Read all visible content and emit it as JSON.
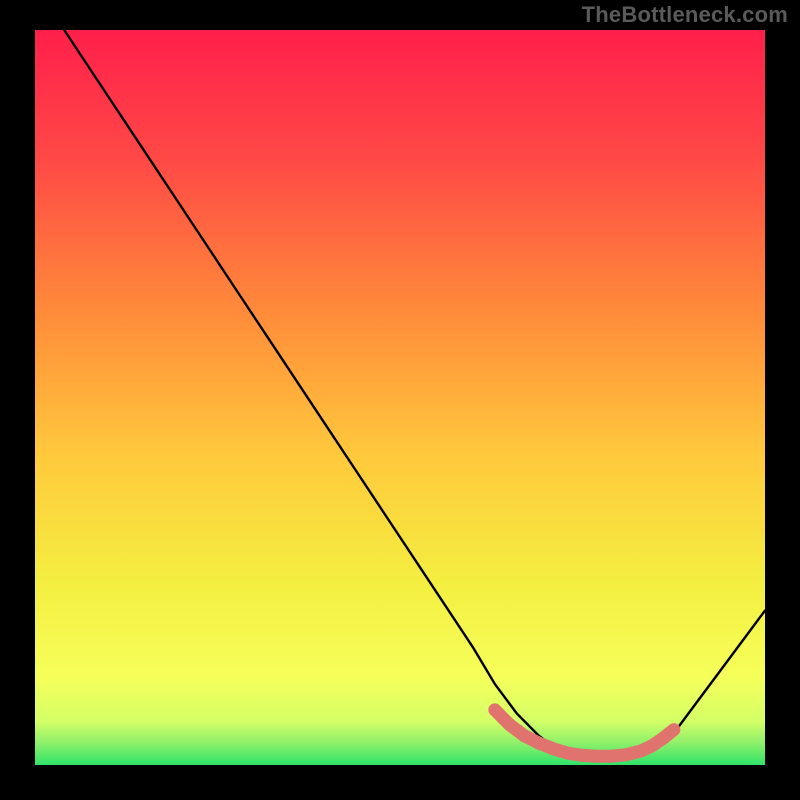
{
  "watermark": "TheBottleneck.com",
  "chart_data": {
    "type": "line",
    "title": "",
    "xlabel": "",
    "ylabel": "",
    "xlim": [
      0,
      100
    ],
    "ylim": [
      0,
      100
    ],
    "grid": false,
    "series": [
      {
        "name": "curve",
        "x": [
          4,
          8,
          12,
          16,
          20,
          24,
          28,
          32,
          36,
          40,
          44,
          48,
          52,
          56,
          60,
          63,
          66,
          69,
          71,
          73,
          75,
          77,
          79,
          81,
          83,
          85,
          88,
          91,
          94,
          97,
          100
        ],
        "y": [
          100,
          94,
          88,
          82,
          76,
          70,
          64,
          58,
          52,
          46,
          40,
          34,
          28,
          22,
          16,
          11,
          7,
          4,
          2.5,
          1.6,
          1.1,
          0.8,
          0.8,
          0.9,
          1.4,
          2.4,
          5,
          9,
          13,
          17,
          21
        ]
      },
      {
        "name": "highlight-dots",
        "x": [
          63,
          65,
          67,
          69,
          71,
          73,
          75,
          77,
          79,
          81,
          83,
          84.5,
          86,
          87.5
        ],
        "y": [
          7.5,
          5.5,
          4,
          3,
          2.2,
          1.6,
          1.3,
          1.2,
          1.2,
          1.4,
          1.9,
          2.6,
          3.6,
          4.8
        ]
      }
    ],
    "colors": {
      "background_gradient_top": "#ff1f4b",
      "background_gradient_mid_upper": "#ff7a3c",
      "background_gradient_mid": "#ffd23c",
      "background_gradient_lower": "#f6ff5a",
      "background_gradient_bottom_green": "#2fe36a",
      "curve_stroke": "#000000",
      "highlight_dot": "#e0736e"
    }
  }
}
